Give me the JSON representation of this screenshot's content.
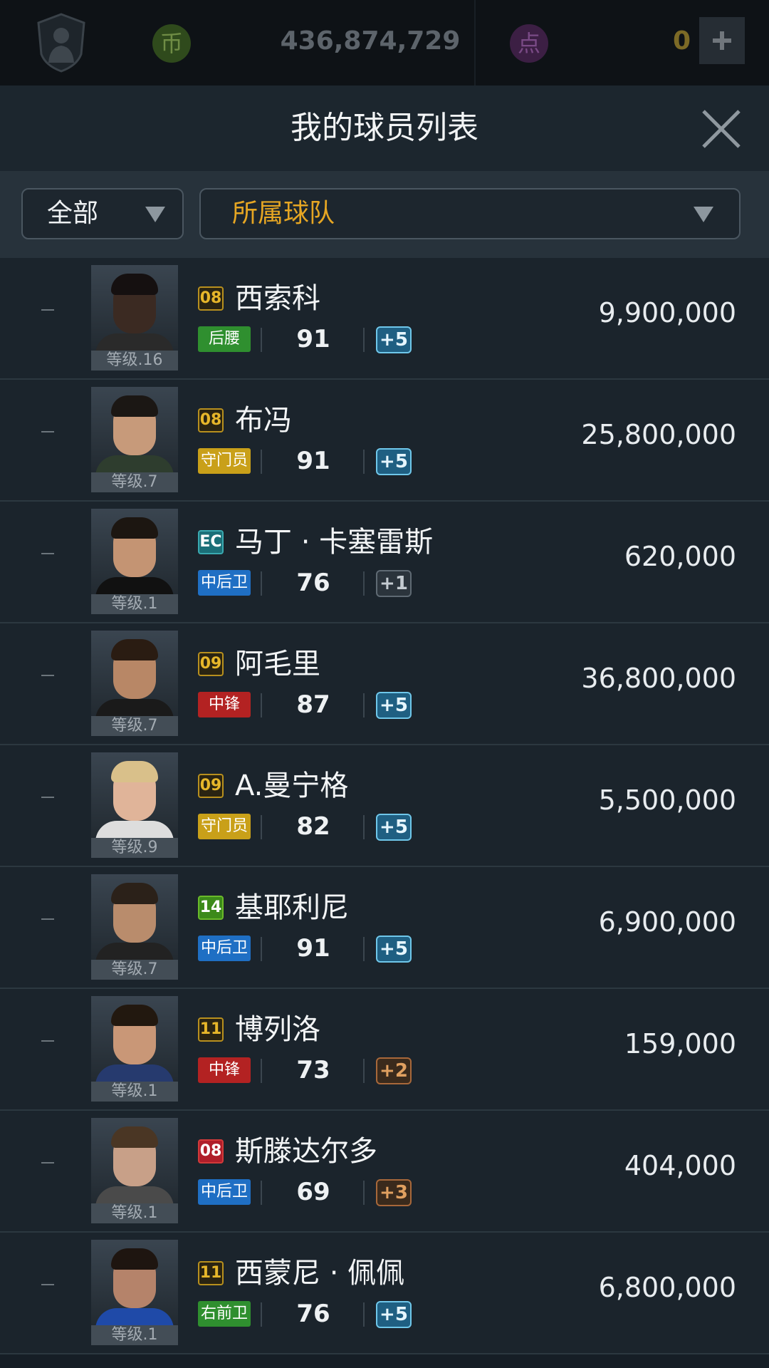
{
  "topbar": {
    "coin_icon": "币",
    "coin_value": "436,874,729",
    "point_icon": "点",
    "point_value": "0",
    "avatar_icon": "manager-avatar-icon",
    "plus_icon": "plus-icon"
  },
  "header": {
    "title": "我的球员列表",
    "close_icon": "close-icon"
  },
  "filters": {
    "category": "全部",
    "team": "所属球队"
  },
  "players": [
    {
      "name": "西索科",
      "season": "08",
      "season_style": "gold",
      "position": "后腰",
      "pos_color": "green",
      "ovr": "91",
      "enhance": "+5",
      "enh_style": "blue",
      "level": "等级.16",
      "price": "9,900,000",
      "skin": "#3b2a22",
      "hair": "#151010",
      "shirt": "#2a2a2a",
      "marker": "–"
    },
    {
      "name": "布冯",
      "season": "08",
      "season_style": "gold",
      "position": "守门员",
      "pos_color": "yellow",
      "ovr": "91",
      "enhance": "+5",
      "enh_style": "blue",
      "level": "等级.7",
      "price": "25,800,000",
      "skin": "#c79a7a",
      "hair": "#1b1714",
      "shirt": "#2e3d2e",
      "marker": "–"
    },
    {
      "name": "马丁 · 卡塞雷斯",
      "season": "EC",
      "season_style": "teal",
      "position": "中后卫",
      "pos_color": "blue",
      "ovr": "76",
      "enhance": "+1",
      "enh_style": "gray",
      "level": "等级.1",
      "price": "620,000",
      "skin": "#c49473",
      "hair": "#1c1611",
      "shirt": "#111111",
      "marker": "–"
    },
    {
      "name": "阿毛里",
      "season": "09",
      "season_style": "gold",
      "position": "中锋",
      "pos_color": "red",
      "ovr": "87",
      "enhance": "+5",
      "enh_style": "blue",
      "level": "等级.7",
      "price": "36,800,000",
      "skin": "#b88766",
      "hair": "#2a1c12",
      "shirt": "#1a1a1a",
      "marker": "–"
    },
    {
      "name": "A.曼宁格",
      "season": "09",
      "season_style": "gold",
      "position": "守门员",
      "pos_color": "yellow",
      "ovr": "82",
      "enhance": "+5",
      "enh_style": "blue",
      "level": "等级.9",
      "price": "5,500,000",
      "skin": "#e0b499",
      "hair": "#d9c08a",
      "shirt": "#dddddd",
      "marker": "–"
    },
    {
      "name": "基耶利尼",
      "season": "14",
      "season_style": "green",
      "position": "中后卫",
      "pos_color": "blue",
      "ovr": "91",
      "enhance": "+5",
      "enh_style": "blue",
      "level": "等级.7",
      "price": "6,900,000",
      "skin": "#b98c6c",
      "hair": "#2b2119",
      "shirt": "#222222",
      "marker": "–"
    },
    {
      "name": "博列洛",
      "season": "11",
      "season_style": "gold",
      "position": "中锋",
      "pos_color": "red",
      "ovr": "73",
      "enhance": "+2",
      "enh_style": "bronze",
      "level": "等级.1",
      "price": "159,000",
      "skin": "#c99777",
      "hair": "#22180f",
      "shirt": "#263a6e",
      "marker": "–"
    },
    {
      "name": "斯滕达尔多",
      "season": "08",
      "season_style": "red",
      "position": "中后卫",
      "pos_color": "blue",
      "ovr": "69",
      "enhance": "+3",
      "enh_style": "bronze",
      "level": "等级.1",
      "price": "404,000",
      "skin": "#c8a088",
      "hair": "#4a3624",
      "shirt": "#4a4a4a",
      "marker": "–"
    },
    {
      "name": "西蒙尼 · 佩佩",
      "season": "11",
      "season_style": "gold",
      "position": "右前卫",
      "pos_color": "green",
      "ovr": "76",
      "enhance": "+5",
      "enh_style": "blue",
      "level": "等级.1",
      "price": "6,800,000",
      "skin": "#b5836a",
      "hair": "#1e1510",
      "shirt": "#1f4aa8",
      "marker": "–"
    }
  ]
}
